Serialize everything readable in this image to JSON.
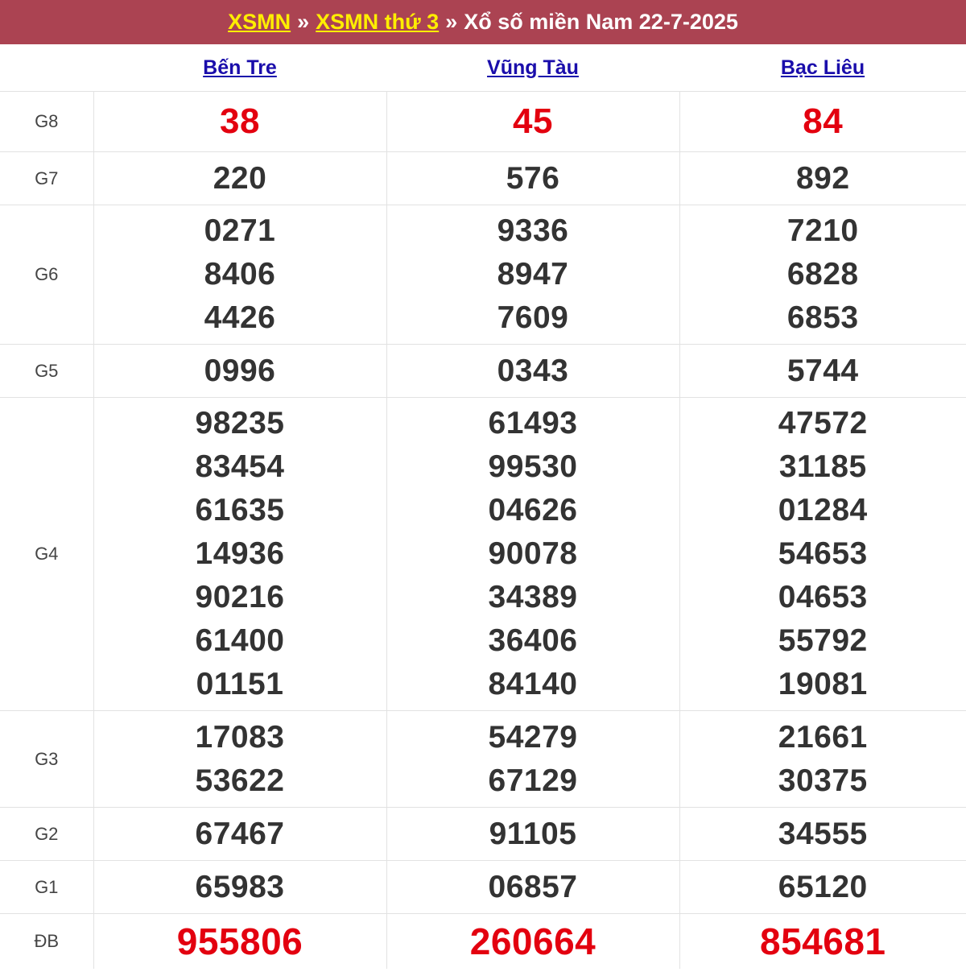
{
  "header": {
    "link1": "XSMN",
    "sep1": "»",
    "link2": "XSMN thứ 3",
    "sep2": "»",
    "text": "Xổ số miền Nam 22-7-2025"
  },
  "provinces": [
    "Bến Tre",
    "Vũng Tàu",
    "Bạc Liêu"
  ],
  "prizes": [
    {
      "label": "G8",
      "key": "g8",
      "numbers": [
        [
          "38"
        ],
        [
          "45"
        ],
        [
          "84"
        ]
      ]
    },
    {
      "label": "G7",
      "key": "g7",
      "numbers": [
        [
          "220"
        ],
        [
          "576"
        ],
        [
          "892"
        ]
      ]
    },
    {
      "label": "G6",
      "key": "g6",
      "numbers": [
        [
          "0271",
          "8406",
          "4426"
        ],
        [
          "9336",
          "8947",
          "7609"
        ],
        [
          "7210",
          "6828",
          "6853"
        ]
      ]
    },
    {
      "label": "G5",
      "key": "g5",
      "numbers": [
        [
          "0996"
        ],
        [
          "0343"
        ],
        [
          "5744"
        ]
      ]
    },
    {
      "label": "G4",
      "key": "g4",
      "numbers": [
        [
          "98235",
          "83454",
          "61635",
          "14936",
          "90216",
          "61400",
          "01151"
        ],
        [
          "61493",
          "99530",
          "04626",
          "90078",
          "34389",
          "36406",
          "84140"
        ],
        [
          "47572",
          "31185",
          "01284",
          "54653",
          "04653",
          "55792",
          "19081"
        ]
      ]
    },
    {
      "label": "G3",
      "key": "g3",
      "numbers": [
        [
          "17083",
          "53622"
        ],
        [
          "54279",
          "67129"
        ],
        [
          "21661",
          "30375"
        ]
      ]
    },
    {
      "label": "G2",
      "key": "g2",
      "numbers": [
        [
          "67467"
        ],
        [
          "91105"
        ],
        [
          "34555"
        ]
      ]
    },
    {
      "label": "G1",
      "key": "g1",
      "numbers": [
        [
          "65983"
        ],
        [
          "06857"
        ],
        [
          "65120"
        ]
      ]
    },
    {
      "label": "ĐB",
      "key": "db",
      "numbers": [
        [
          "955806"
        ],
        [
          "260664"
        ],
        [
          "854681"
        ]
      ]
    }
  ],
  "colors": {
    "header_bg": "#ab4352",
    "header_link": "#ffee00",
    "province_link": "#1a0dab",
    "highlight_number": "#e3000f",
    "number": "#333333"
  }
}
